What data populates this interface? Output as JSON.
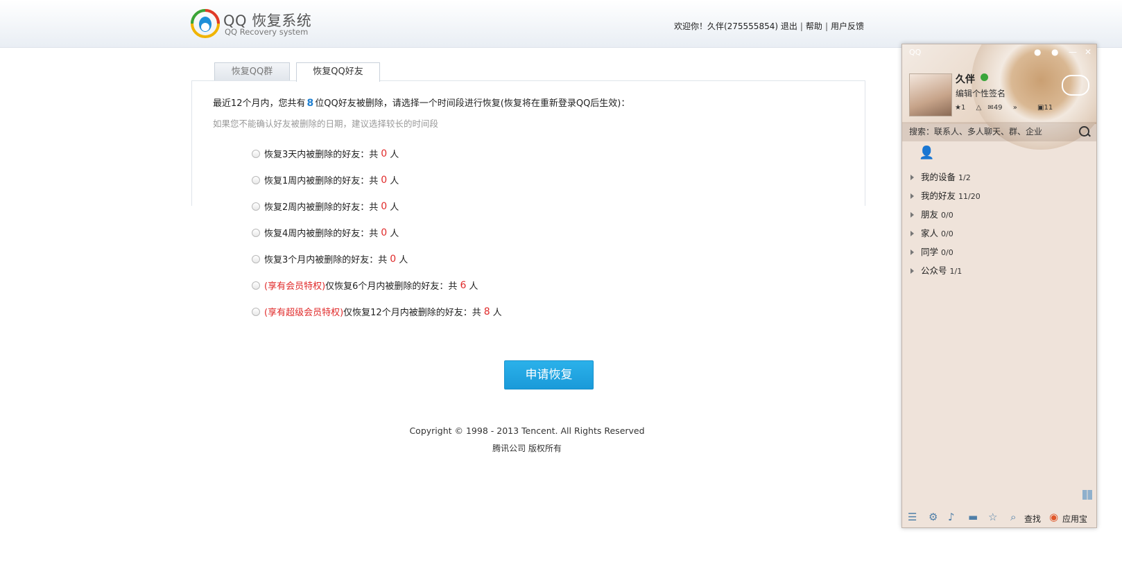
{
  "header": {
    "logo_title": "QQ 恢复系统",
    "logo_subtitle": "QQ Recovery system",
    "welcome": "欢迎你！久伴(275555854)",
    "logout": "退出",
    "help": "帮助",
    "feedback": "用户反馈"
  },
  "tabs": {
    "group": "恢复QQ群",
    "friends": "恢复QQ好友"
  },
  "intro": {
    "prefix": "最近12个月内，您共有",
    "count": "8",
    "suffix": "位QQ好友被删除，请选择一个时间段进行恢复(恢复将在重新登录QQ后生效)：",
    "hint": "如果您不能确认好友被删除的日期，建议选择较长的时间段"
  },
  "options": [
    {
      "vip": "",
      "label": "恢复3天内被删除的好友：共",
      "count": "0",
      "unit": "人"
    },
    {
      "vip": "",
      "label": "恢复1周内被删除的好友：共",
      "count": "0",
      "unit": "人"
    },
    {
      "vip": "",
      "label": "恢复2周内被删除的好友：共",
      "count": "0",
      "unit": "人"
    },
    {
      "vip": "",
      "label": "恢复4周内被删除的好友：共",
      "count": "0",
      "unit": "人"
    },
    {
      "vip": "",
      "label": "恢复3个月内被删除的好友：共",
      "count": "0",
      "unit": "人"
    },
    {
      "vip": "(享有会员特权)",
      "label": "仅恢复6个月内被删除的好友：共",
      "count": "6",
      "unit": "人"
    },
    {
      "vip": "(享有超级会员特权)",
      "label": "仅恢复12个月内被删除的好友：共",
      "count": "8",
      "unit": "人"
    }
  ],
  "apply_button": "申请恢复",
  "footer": {
    "copyright": "Copyright © 1998 - 2013 Tencent. All Rights Reserved",
    "company": "腾讯公司 版权所有"
  },
  "qq_client": {
    "logo": "QQ",
    "name": "久伴",
    "signature": "编辑个性签名",
    "icon_counts": {
      "star": "1",
      "mail": "49",
      "right": "11"
    },
    "search_placeholder": "搜索：联系人、多人聊天、群、企业",
    "groups": [
      {
        "name": "我的设备",
        "count": "1/2"
      },
      {
        "name": "我的好友",
        "count": "11/20"
      },
      {
        "name": "朋友",
        "count": "0/0"
      },
      {
        "name": "家人",
        "count": "0/0"
      },
      {
        "name": "同学",
        "count": "0/0"
      },
      {
        "name": "公众号",
        "count": "1/1"
      }
    ],
    "bottom": {
      "find": "查找",
      "app": "应用宝"
    }
  },
  "colors": {
    "accent": "#1e7fd1",
    "count_red": "#e02a2a",
    "button": "#1a9ad9"
  }
}
